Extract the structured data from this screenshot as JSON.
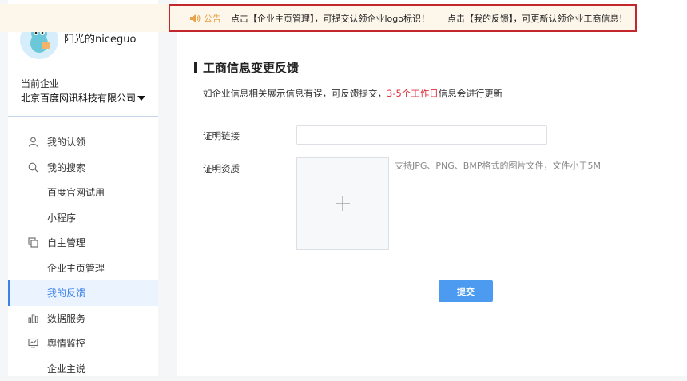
{
  "sidebar": {
    "username": "阳光的niceguo",
    "company_label": "当前企业",
    "company_name": "北京百度网讯科技有限公司",
    "items": [
      {
        "label": "我的认领",
        "icon": "user-icon"
      },
      {
        "label": "我的搜索",
        "icon": "search-icon"
      },
      {
        "label": "百度官网试用"
      },
      {
        "label": "小程序"
      },
      {
        "label": "自主管理",
        "icon": "copy-icon"
      },
      {
        "label": "企业主页管理"
      },
      {
        "label": "我的反馈",
        "active": true
      },
      {
        "label": "数据服务",
        "icon": "bar-chart-icon"
      },
      {
        "label": "舆情监控",
        "icon": "monitor-icon"
      },
      {
        "label": "企业主说"
      }
    ]
  },
  "notice": {
    "tag": "公告",
    "message1": "点击【企业主页管理】，可提交认领企业logo标识！",
    "message2": "点击【我的反馈】，可更新认领企业工商信息！"
  },
  "main": {
    "title": "工商信息变更反馈",
    "desc_prefix": "如企业信息相关展示信息有误，可反馈提交，",
    "desc_highlight": "3-5个工作日",
    "desc_suffix": "信息会进行更新",
    "link_label": "证明链接",
    "link_value": "",
    "cert_label": "证明资质",
    "upload_hint": "支持JPG、PNG、BMP格式的图片文件，文件小于5M",
    "submit_label": "提交"
  },
  "colors": {
    "accent": "#4c9bf0",
    "active_menu": "#3b82e6",
    "highlight": "#e0303b",
    "notice_bg": "#fdf6ea",
    "notice_border": "#c4262e"
  }
}
